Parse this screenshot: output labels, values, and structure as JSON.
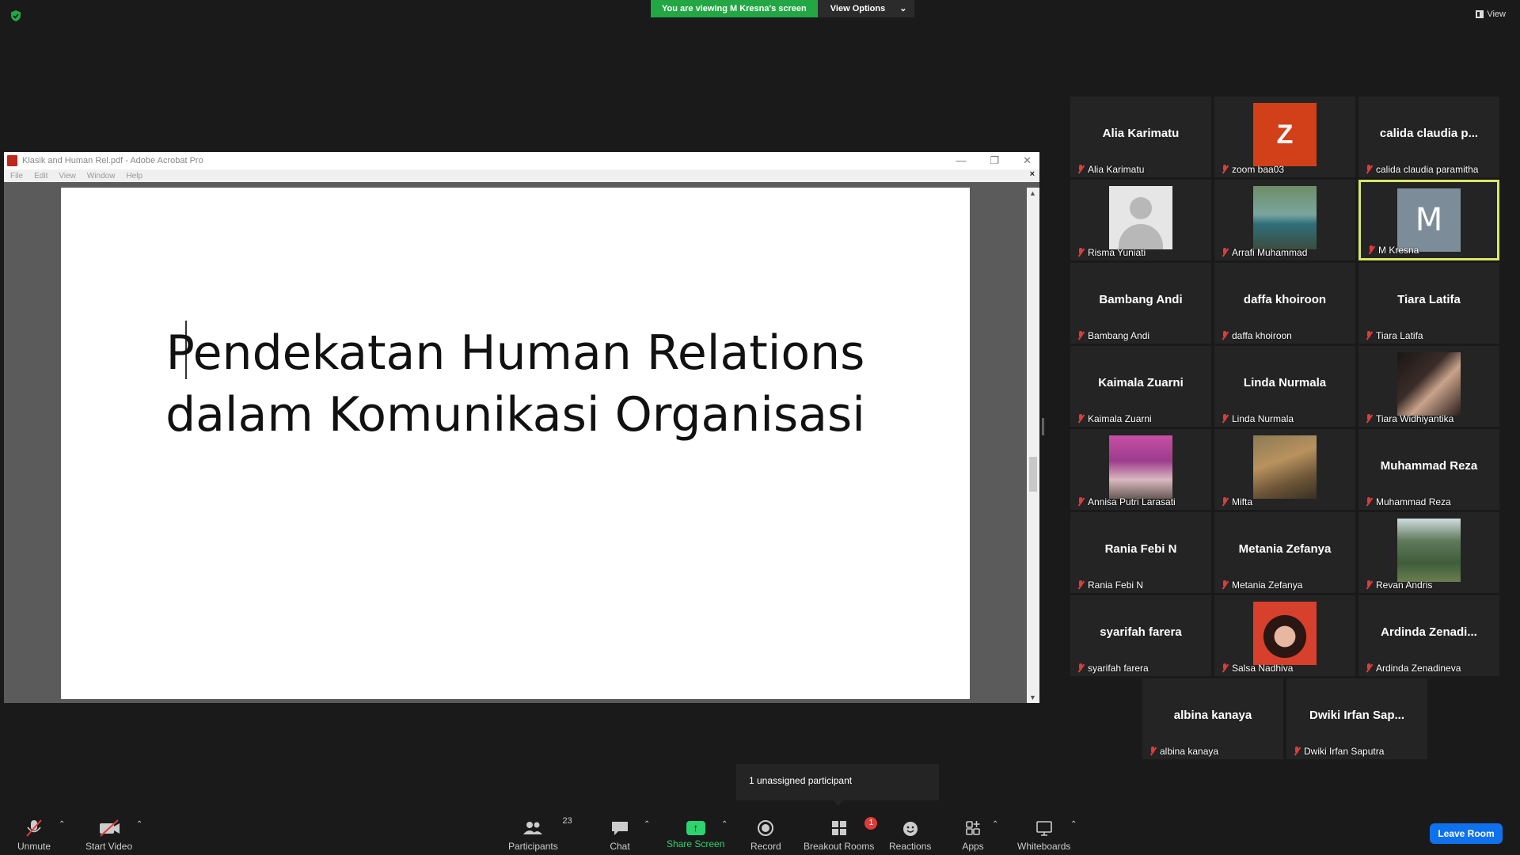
{
  "top": {
    "viewing_banner": "You are viewing M Kresna's screen",
    "view_options": "View Options",
    "view_label": "View"
  },
  "shared_window": {
    "title": "Klasik and Human Rel.pdf - Adobe Acrobat Pro",
    "menu": [
      "File",
      "Edit",
      "View",
      "Window",
      "Help"
    ],
    "close_x": "×",
    "slide_title_line1": "Pendekatan Human Relations",
    "slide_title_line2": "dalam Komunikasi Organisasi"
  },
  "participants": [
    {
      "display": "Alia Karimatu",
      "label": "Alia Karimatu",
      "type": "name"
    },
    {
      "display": "Z",
      "label": "zoom baa03",
      "type": "letter-z"
    },
    {
      "display": "calida  claudia  p...",
      "label": "calida claudia paramitha",
      "type": "name"
    },
    {
      "display": "",
      "label": "Risma Yuniati",
      "type": "default"
    },
    {
      "display": "",
      "label": "Arrafi Muhammad",
      "type": "photo1"
    },
    {
      "display": "M",
      "label": "M Kresna",
      "type": "letter-m"
    },
    {
      "display": "Bambang Andi",
      "label": "Bambang Andi",
      "type": "name"
    },
    {
      "display": "daffa khoiroon",
      "label": "daffa khoiroon",
      "type": "name"
    },
    {
      "display": "Tiara Latifa",
      "label": "Tiara Latifa",
      "type": "name"
    },
    {
      "display": "Kaimala Zuarni",
      "label": "Kaimala Zuarni",
      "type": "name"
    },
    {
      "display": "Linda Nurmala",
      "label": "Linda Nurmala",
      "type": "name"
    },
    {
      "display": "",
      "label": "Tiara Widhiyantika",
      "type": "photo2"
    },
    {
      "display": "",
      "label": "Annisa Putri Larasati",
      "type": "photo3"
    },
    {
      "display": "",
      "label": "Mifta",
      "type": "photo4"
    },
    {
      "display": "Muhammad Reza",
      "label": "Muhammad Reza",
      "type": "name"
    },
    {
      "display": "Rania Febi N",
      "label": "Rania Febi N",
      "type": "name"
    },
    {
      "display": "Metania Zefanya",
      "label": "Metania Zefanya",
      "type": "name"
    },
    {
      "display": "",
      "label": "Revan Andris",
      "type": "photo5"
    },
    {
      "display": "syarifah farera",
      "label": "syarifah farera",
      "type": "name"
    },
    {
      "display": "",
      "label": "Salsa Nadhiva",
      "type": "photo6"
    },
    {
      "display": "Ardinda  Zenadi...",
      "label": "Ardinda Zenadineva",
      "type": "name"
    },
    {
      "display": "albina kanaya",
      "label": "albina kanaya",
      "type": "name"
    },
    {
      "display": "Dwiki  Irfan  Sap...",
      "label": "Dwiki Irfan Saputra",
      "type": "name"
    }
  ],
  "popup": "1 unassigned participant",
  "toolbar": {
    "unmute": "Unmute",
    "start_video": "Start Video",
    "participants": "Participants",
    "participants_count": "23",
    "chat": "Chat",
    "share_screen": "Share Screen",
    "record": "Record",
    "breakout_rooms": "Breakout Rooms",
    "breakout_badge": "1",
    "reactions": "Reactions",
    "apps": "Apps",
    "whiteboards": "Whiteboards",
    "leave_room": "Leave Room"
  },
  "colors": {
    "banner_green": "#23a744",
    "muted_red": "#e03b3b",
    "active_speaker": "#d8e66a",
    "leave_blue": "#0e72ed"
  }
}
